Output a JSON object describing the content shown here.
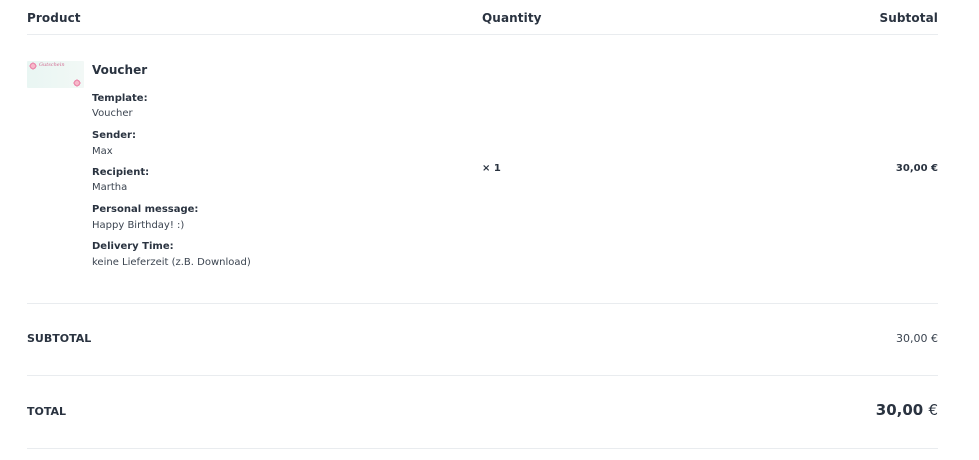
{
  "table": {
    "headers": {
      "product": "Product",
      "quantity": "Quantity",
      "subtotal": "Subtotal"
    }
  },
  "item": {
    "name": "Voucher",
    "thumbnail_text": "Gutschein",
    "details": [
      {
        "label": "Template:",
        "value": "Voucher"
      },
      {
        "label": "Sender:",
        "value": "Max"
      },
      {
        "label": "Recipient:",
        "value": "Martha"
      },
      {
        "label": "Personal message:",
        "value": "Happy Birthday! :)"
      },
      {
        "label": "Delivery Time:",
        "value": "keine Lieferzeit (z.B. Download)"
      }
    ],
    "quantity": "× 1",
    "subtotal": "30,00 €"
  },
  "summary": {
    "subtotal_label": "SUBTOTAL",
    "subtotal_value": "30,00 €",
    "total_label": "TOTAL",
    "total_amount": "30,00",
    "total_currency": "€"
  },
  "colors": {
    "text": "#2a3340",
    "divider": "#e9ecef",
    "thumbnail_bg": "#eaf6f3",
    "accent_pink": "#ec8fb0"
  }
}
